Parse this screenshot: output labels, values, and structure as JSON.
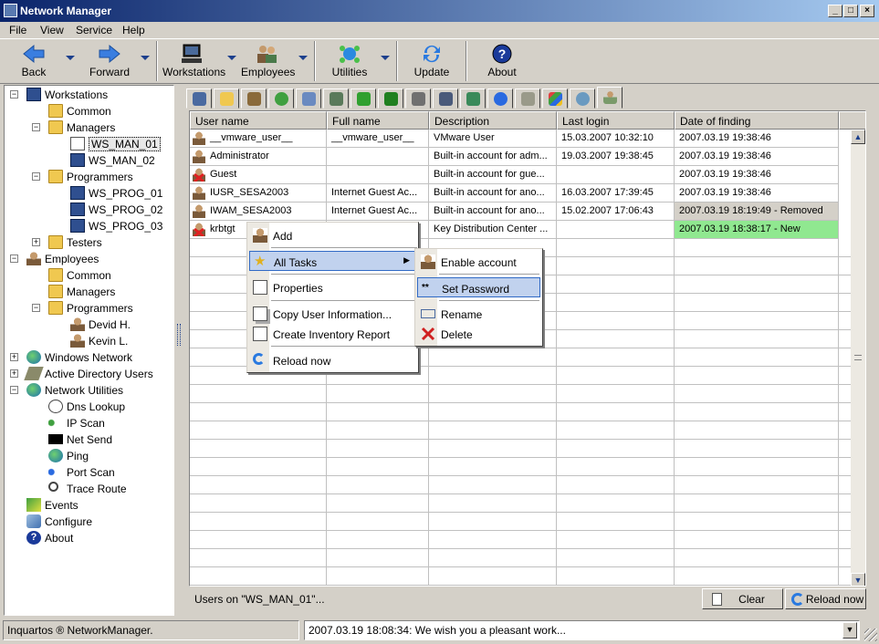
{
  "window": {
    "title": "Network Manager"
  },
  "menu": [
    "File",
    "View",
    "Service",
    "Help"
  ],
  "toolbar": {
    "back": "Back",
    "forward": "Forward",
    "workstations": "Workstations",
    "employees": "Employees",
    "utilities": "Utilities",
    "update": "Update",
    "about": "About"
  },
  "tree": {
    "workstations": "Workstations",
    "ws_common": "Common",
    "ws_managers": "Managers",
    "ws_man_01": "WS_MAN_01",
    "ws_man_02": "WS_MAN_02",
    "ws_programmers": "Programmers",
    "ws_prog_01": "WS_PROG_01",
    "ws_prog_02": "WS_PROG_02",
    "ws_prog_03": "WS_PROG_03",
    "ws_testers": "Testers",
    "employees": "Employees",
    "emp_common": "Common",
    "emp_managers": "Managers",
    "emp_programmers": "Programmers",
    "emp_devid": "Devid H.",
    "emp_kevin": "Kevin L.",
    "windows_network": "Windows Network",
    "ad_users": "Active Directory Users",
    "network_utilities": "Network Utilities",
    "dns_lookup": "Dns Lookup",
    "ip_scan": "IP Scan",
    "net_send": "Net Send",
    "ping": "Ping",
    "port_scan": "Port Scan",
    "trace_route": "Trace Route",
    "events": "Events",
    "configure": "Configure",
    "about": "About"
  },
  "grid": {
    "columns": [
      "User name",
      "Full name",
      "Description",
      "Last login",
      "Date of finding"
    ],
    "rows": [
      {
        "user": "__vmware_user__",
        "full": "__vmware_user__",
        "desc": "VMware User",
        "last": "15.03.2007 10:32:10",
        "found": "2007.03.19 19:38:46",
        "status": "normal"
      },
      {
        "user": "Administrator",
        "full": "",
        "desc": "Built-in account for adm...",
        "last": "19.03.2007 19:38:45",
        "found": "2007.03.19 19:38:46",
        "status": "normal"
      },
      {
        "user": "Guest",
        "full": "",
        "desc": "Built-in account for gue...",
        "last": "",
        "found": "2007.03.19 19:38:46",
        "status": "disabled"
      },
      {
        "user": "IUSR_SESA2003",
        "full": "Internet Guest Ac...",
        "desc": "Built-in account for ano...",
        "last": "16.03.2007 17:39:45",
        "found": "2007.03.19 19:38:46",
        "status": "normal"
      },
      {
        "user": "IWAM_SESA2003",
        "full": "Internet Guest Ac...",
        "desc": "Built-in account for ano...",
        "last": "15.02.2007 17:06:43",
        "found": "2007.03.19 18:19:49 - Removed",
        "status": "removed"
      },
      {
        "user": "krbtgt",
        "full": "",
        "desc": "Key Distribution Center ...",
        "last": "",
        "found": "2007.03.19 18:38:17 - New",
        "status": "new"
      }
    ],
    "footer_label": "Users on \"WS_MAN_01\"...",
    "clear": "Clear",
    "reload": "Reload now"
  },
  "context_menu": {
    "add": "Add",
    "all_tasks": "All Tasks",
    "properties": "Properties",
    "copy_user_info": "Copy User Information...",
    "create_report": "Create Inventory Report",
    "reload_now": "Reload now"
  },
  "submenu": {
    "enable_account": "Enable account",
    "set_password": "Set Password",
    "rename": "Rename",
    "delete": "Delete",
    "password_glyph": "**"
  },
  "status": {
    "left": "Inquartos ® NetworkManager.",
    "message": "2007.03.19 18:08:34: We wish you a pleasant work..."
  },
  "colors": {
    "removed": "#d4d0c8",
    "new": "#90e890",
    "highlight": "#c1d2ee",
    "title_start": "#0a246a"
  }
}
